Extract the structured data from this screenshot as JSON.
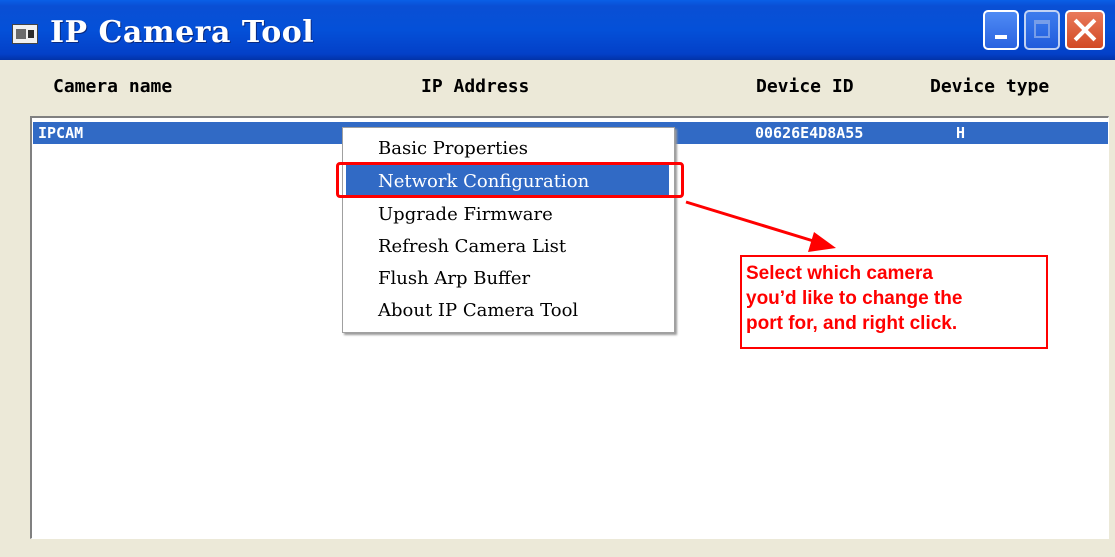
{
  "window": {
    "title": "IP Camera Tool",
    "icon": "app-icon"
  },
  "columns": {
    "name": "Camera name",
    "ip": "IP Address",
    "device_id": "Device ID",
    "device_type": "Device type"
  },
  "rows": [
    {
      "name": "IPCAM",
      "ip": "",
      "device_id": "00626E4D8A55",
      "device_type": "H",
      "selected": true
    }
  ],
  "context_menu": {
    "items": [
      {
        "label": "Basic Properties"
      },
      {
        "label": "Network Configuration",
        "highlighted": true
      },
      {
        "label": "Upgrade Firmware"
      },
      {
        "label": "Refresh Camera List"
      },
      {
        "label": "Flush Arp Buffer"
      },
      {
        "label": "About IP Camera Tool"
      }
    ]
  },
  "annotation": {
    "lines": [
      "Select which camera",
      "you’d like to change the",
      "port for, and right click."
    ],
    "color": "#FF0000"
  },
  "colors": {
    "titlebar": "#0450D8",
    "selection": "#316AC5",
    "annotation": "#FF0000",
    "window_bg": "#ECE9D8"
  }
}
